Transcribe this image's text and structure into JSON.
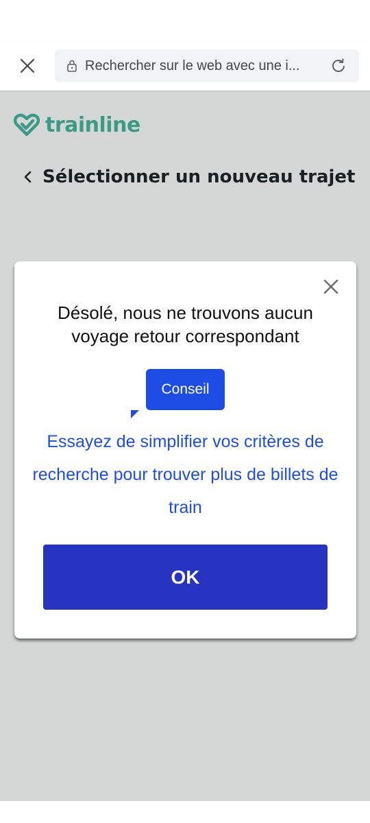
{
  "browser": {
    "url_text": "Rechercher sur le web avec une i...",
    "icons": {
      "close": "close-icon",
      "lock": "lock-icon",
      "reload": "reload-icon"
    }
  },
  "app": {
    "logo_text": "trainline",
    "logo_icon": "heart-check-icon",
    "brand_color": "#3c9b84",
    "page_title": "Sélectionner un nouveau trajet"
  },
  "modal": {
    "heading": "Désolé, nous ne trouvons aucun voyage retour correspondant",
    "tip_badge": "Conseil",
    "tip_text": "Essayez de simplifier vos critères de recherche pour trouver plus de billets de train",
    "ok_label": "OK",
    "accent_color": "#1e4de6",
    "button_color": "#2733c1"
  }
}
